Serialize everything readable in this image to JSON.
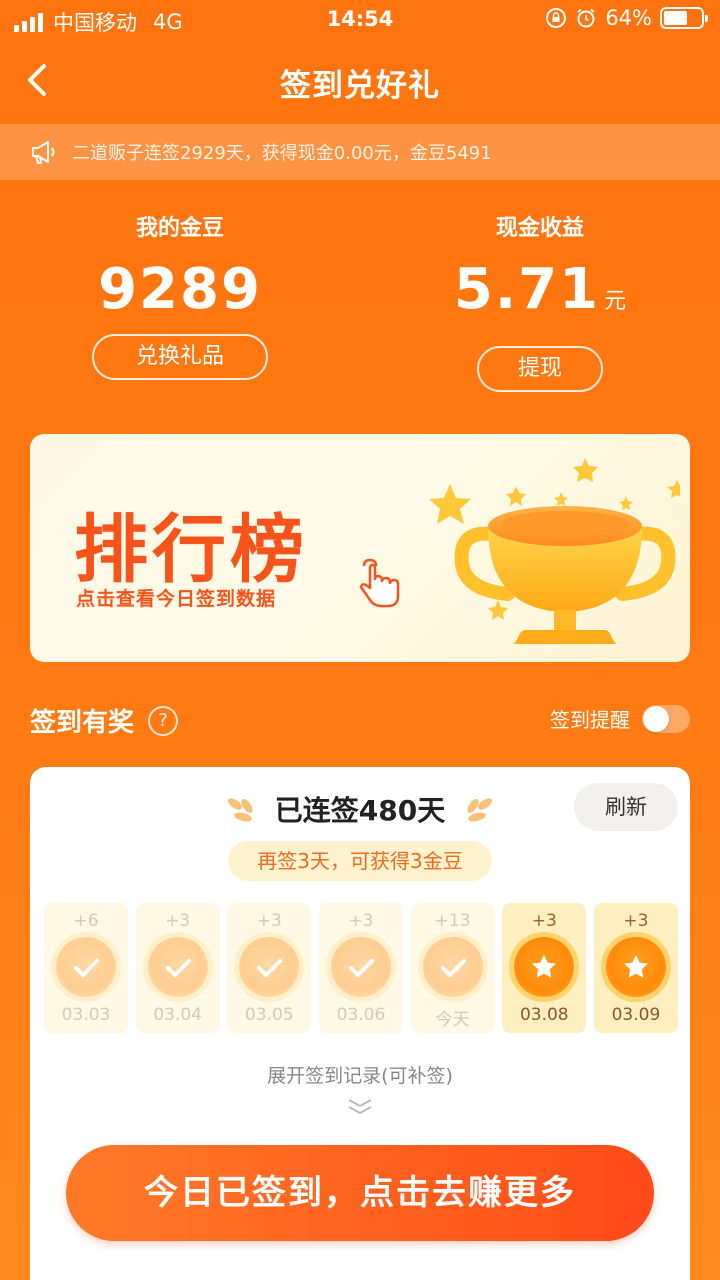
{
  "status_bar": {
    "carrier": "中国移动",
    "network": "4G",
    "time": "14:54",
    "battery": "64%",
    "battery_level": 0.64
  },
  "nav": {
    "title": "签到兑好礼"
  },
  "notice": {
    "text": "二道贩子连签2929天，获得现金0.00元，金豆5491"
  },
  "stats": {
    "beans": {
      "label": "我的金豆",
      "value": "9289",
      "button": "兑换礼品"
    },
    "cash": {
      "label": "现金收益",
      "value": "5.71",
      "unit": "元",
      "button": "提现"
    }
  },
  "ranking": {
    "title": "排行榜",
    "subtitle": "点击查看今日签到数据"
  },
  "checkin": {
    "section_title": "签到有奖",
    "reminder_label": "签到提醒",
    "reminder_on": false,
    "streak": "已连签480天",
    "refresh": "刷新",
    "hint": "再签3天，可获得3金豆",
    "days": [
      {
        "bonus": "+6",
        "date": "03.03",
        "state": "done"
      },
      {
        "bonus": "+3",
        "date": "03.04",
        "state": "done"
      },
      {
        "bonus": "+3",
        "date": "03.05",
        "state": "done"
      },
      {
        "bonus": "+3",
        "date": "03.06",
        "state": "done"
      },
      {
        "bonus": "+13",
        "date": "今天",
        "state": "done"
      },
      {
        "bonus": "+3",
        "date": "03.08",
        "state": "future"
      },
      {
        "bonus": "+3",
        "date": "03.09",
        "state": "future"
      }
    ],
    "expand": "展开签到记录(可补签)",
    "cta": "今日已签到，点击去赚更多"
  },
  "colors": {
    "primary": "#ff7410",
    "accent_text": "#f7541b",
    "cta": "#ff5a1c"
  }
}
